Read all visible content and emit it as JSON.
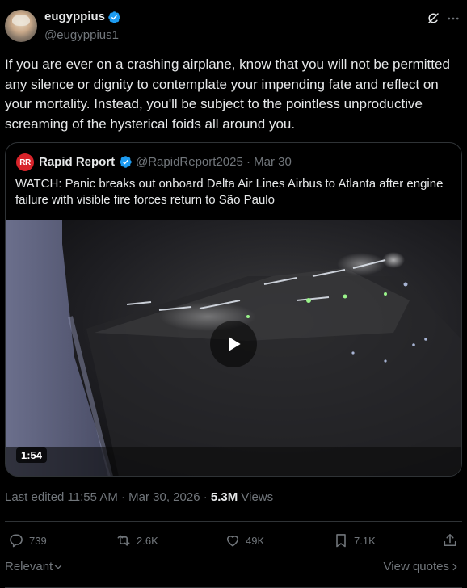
{
  "author": {
    "display_name": "eugyppius",
    "handle": "@eugyppius1",
    "verified": true
  },
  "tweet": {
    "text": "If you are ever on a crashing airplane, know that you will not be permitted any silence or dignity to contemplate your impending fate and reflect on your mortality. Instead, you'll be subject to the pointless unproductive screaming of the hysterical foids all around you."
  },
  "quote": {
    "avatar_initials": "RR",
    "display_name": "Rapid Report",
    "handle_date": "@RapidReport2025 · Mar 30",
    "text": "WATCH: Panic breaks out onboard Delta Air Lines Airbus to Atlanta after engine failure with visible fire forces return to São Paulo",
    "video": {
      "duration": "1:54"
    }
  },
  "meta": {
    "edited": "Last edited 11:55 AM · Mar 30, 2026 · ",
    "views_count": "5.3M",
    "views_label": " Views"
  },
  "actions": {
    "replies": "739",
    "reposts": "2.6K",
    "likes": "49K",
    "bookmarks": "7.1K"
  },
  "footer": {
    "sort_label": "Relevant",
    "view_quotes_label": "View quotes"
  },
  "colors": {
    "background": "#000000",
    "text": "#e7e9ea",
    "muted": "#71767b",
    "border": "#2f3336",
    "verified": "#1d9bf0",
    "brand_red": "#d8232a"
  }
}
